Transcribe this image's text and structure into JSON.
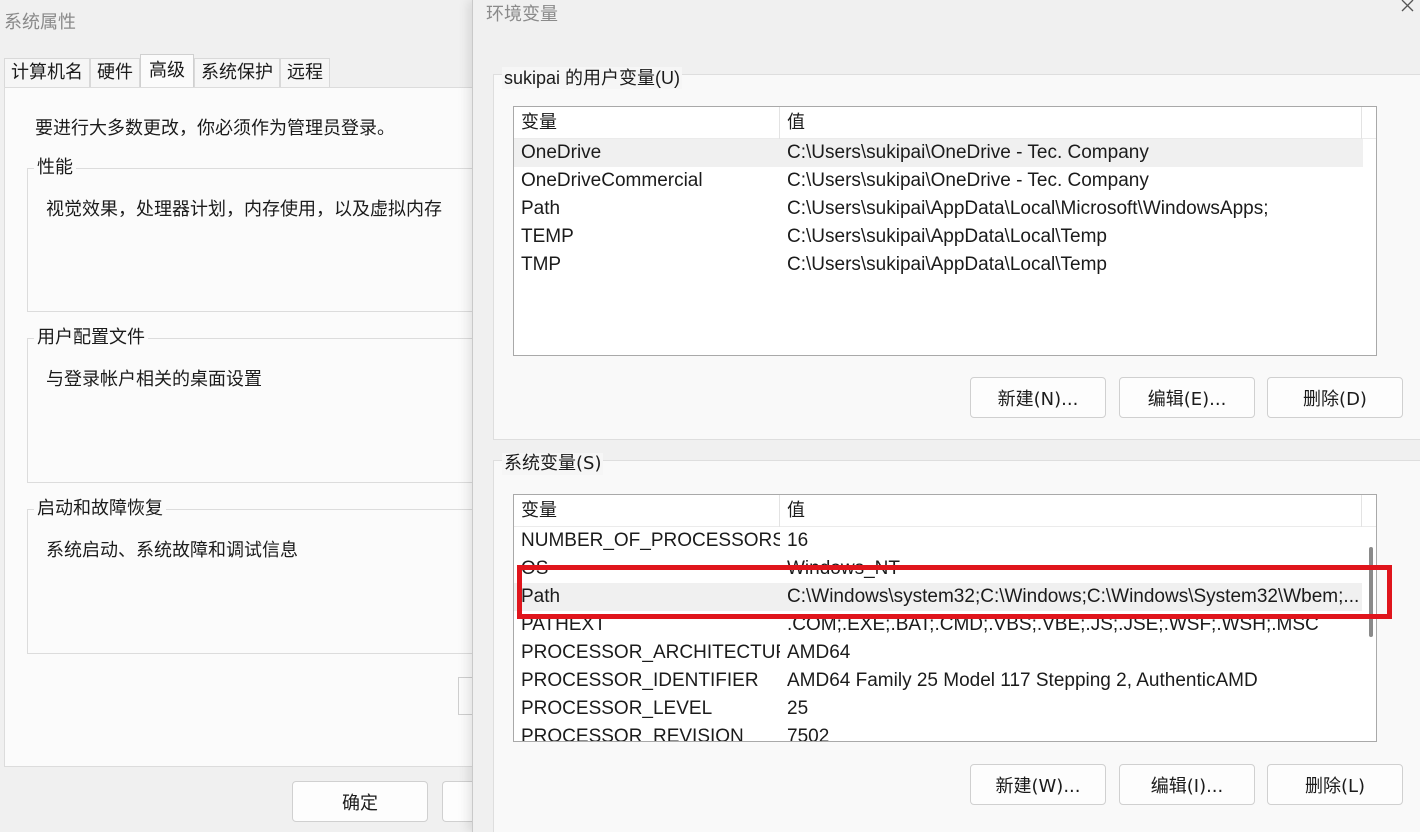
{
  "system_properties": {
    "title": "系统属性",
    "tabs": [
      {
        "label": "计算机名"
      },
      {
        "label": "硬件"
      },
      {
        "label": "高级",
        "active": true
      },
      {
        "label": "系统保护"
      },
      {
        "label": "远程"
      }
    ],
    "admin_note": "要进行大多数更改，你必须作为管理员登录。",
    "groups": [
      {
        "title": "性能",
        "description": "视觉效果，处理器计划，内存使用，以及虚拟内存"
      },
      {
        "title": "用户配置文件",
        "description": "与登录帐户相关的桌面设置"
      },
      {
        "title": "启动和故障恢复",
        "description": "系统启动、系统故障和调试信息"
      }
    ],
    "ok_label": "确定"
  },
  "env_vars": {
    "title": "环境变量",
    "close_icon": "close-icon",
    "user_section": {
      "title": "sukipai 的用户变量(U)",
      "columns": {
        "name": "变量",
        "value": "值"
      },
      "rows": [
        {
          "name": "OneDrive",
          "value": "C:\\Users\\sukipai\\OneDrive - Tec. Company",
          "selected": true
        },
        {
          "name": "OneDriveCommercial",
          "value": "C:\\Users\\sukipai\\OneDrive - Tec. Company"
        },
        {
          "name": "Path",
          "value": "C:\\Users\\sukipai\\AppData\\Local\\Microsoft\\WindowsApps;"
        },
        {
          "name": "TEMP",
          "value": "C:\\Users\\sukipai\\AppData\\Local\\Temp"
        },
        {
          "name": "TMP",
          "value": "C:\\Users\\sukipai\\AppData\\Local\\Temp"
        }
      ],
      "buttons": {
        "new": "新建(N)...",
        "edit": "编辑(E)...",
        "delete": "删除(D)"
      }
    },
    "system_section": {
      "title": "系统变量(S)",
      "columns": {
        "name": "变量",
        "value": "值"
      },
      "rows": [
        {
          "name": "NUMBER_OF_PROCESSORS",
          "value": "16"
        },
        {
          "name": "OS",
          "value": "Windows_NT"
        },
        {
          "name": "Path",
          "value": "C:\\Windows\\system32;C:\\Windows;C:\\Windows\\System32\\Wbem;...",
          "selected": true
        },
        {
          "name": "PATHEXT",
          "value": ".COM;.EXE;.BAT;.CMD;.VBS;.VBE;.JS;.JSE;.WSF;.WSH;.MSC"
        },
        {
          "name": "PROCESSOR_ARCHITECTURE",
          "value": "AMD64"
        },
        {
          "name": "PROCESSOR_IDENTIFIER",
          "value": "AMD64 Family 25 Model 117 Stepping 2, AuthenticAMD"
        },
        {
          "name": "PROCESSOR_LEVEL",
          "value": "25"
        },
        {
          "name": "PROCESSOR_REVISION",
          "value": "7502"
        }
      ],
      "buttons": {
        "new": "新建(W)...",
        "edit": "编辑(I)...",
        "delete": "删除(L)"
      },
      "highlight_color": "#e0151c"
    }
  }
}
